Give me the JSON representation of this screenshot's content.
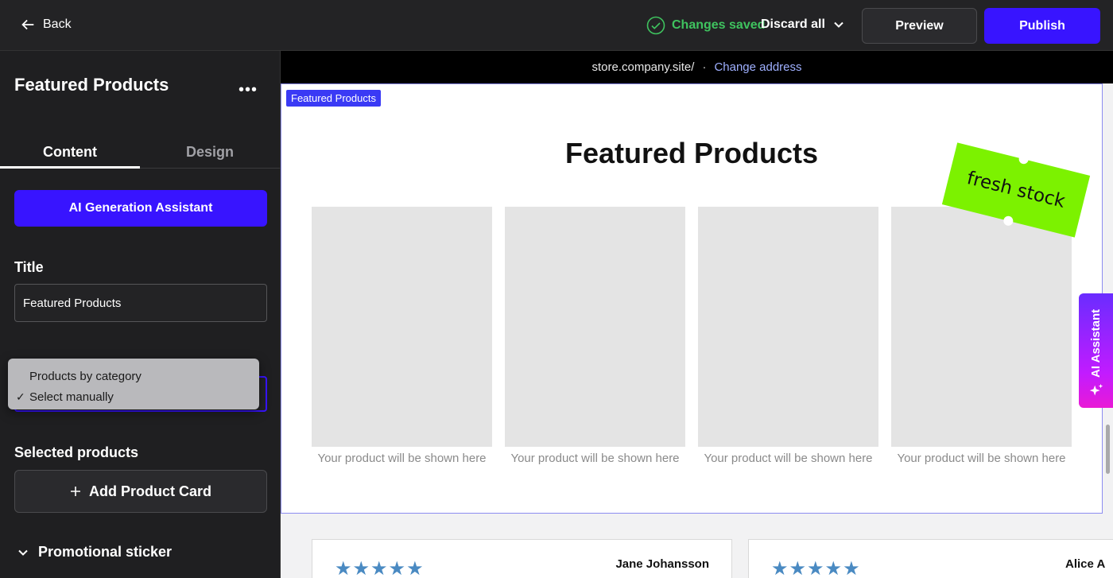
{
  "topbar": {
    "back_label": "Back",
    "status": "Changes saved",
    "discard_label": "Discard all",
    "preview_label": "Preview",
    "publish_label": "Publish",
    "colors": {
      "accent": "#3814ff",
      "saved": "#3fc35f"
    }
  },
  "sidebar": {
    "title": "Featured Products",
    "more_icon": "more-horizontal-icon",
    "tabs": [
      {
        "label": "Content",
        "active": true
      },
      {
        "label": "Design",
        "active": false
      }
    ],
    "ai_button_label": "AI Generation Assistant",
    "title_label": "Title",
    "title_value": "Featured Products",
    "products_select": {
      "options": [
        {
          "label": "Products by category",
          "selected": false
        },
        {
          "label": "Select manually",
          "selected": true
        }
      ]
    },
    "selected_products_label": "Selected products",
    "add_product_label": "Add Product Card",
    "promo_label": "Promotional sticker"
  },
  "canvas": {
    "address": "store.company.site/",
    "separator": "·",
    "change_address_label": "Change address",
    "section_tag": "Featured Products",
    "section_title": "Featured Products",
    "sticker_text": "fresh stock",
    "product_placeholder": "Your product will be shown here",
    "products": [
      {
        "caption": "Your product will be shown here"
      },
      {
        "caption": "Your product will be shown here"
      },
      {
        "caption": "Your product will be shown here"
      },
      {
        "caption": "Your product will be shown here"
      }
    ],
    "ai_assistant_label": "AI Assistant",
    "reviews": [
      {
        "stars": "★★★★★",
        "name": "Jane Johansson"
      },
      {
        "stars": "★★★★★",
        "name": "Alice A"
      }
    ]
  }
}
